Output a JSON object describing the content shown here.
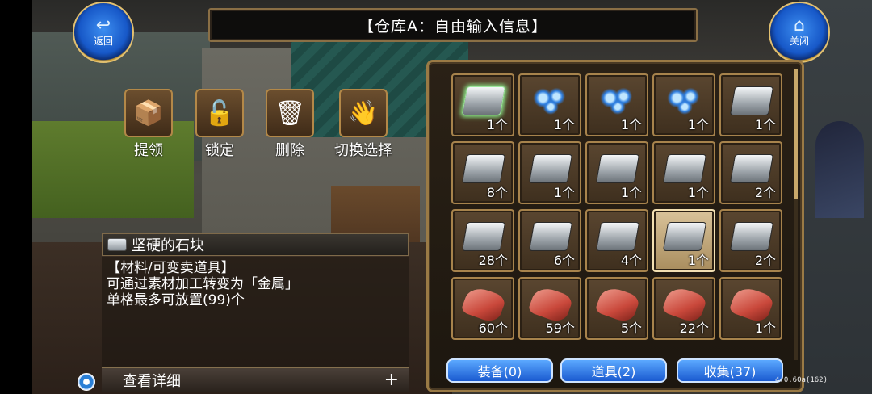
{
  "nav": {
    "back_label": "返回",
    "close_label": "关闭"
  },
  "title": "【仓库A：自由输入信息】",
  "actions": {
    "take": "提领",
    "lock": "锁定",
    "delete": "删除",
    "switch": "切换选择"
  },
  "selected_item": {
    "name": "坚硬的石块",
    "desc_lines": [
      "【材料/可变卖道具】",
      "可通过素材加工转变为「金属」",
      "单格最多可放置(99)个"
    ],
    "detail_label": "查看详细",
    "detail_plus": "+"
  },
  "inventory": {
    "slots": [
      {
        "icon": "rare-ingot-icon",
        "count": "1个"
      },
      {
        "icon": "blue-crystal-icon",
        "count": "1个"
      },
      {
        "icon": "blue-crystal-icon",
        "count": "1个"
      },
      {
        "icon": "blue-crystal-icon",
        "count": "1个"
      },
      {
        "icon": "ingot-icon",
        "count": "1个"
      },
      {
        "icon": "ingot-icon",
        "count": "8个"
      },
      {
        "icon": "ingot-icon",
        "count": "1个"
      },
      {
        "icon": "ingot-icon",
        "count": "1个"
      },
      {
        "icon": "ingot-icon",
        "count": "1个"
      },
      {
        "icon": "ingot-icon",
        "count": "2个"
      },
      {
        "icon": "ingot-icon",
        "count": "28个"
      },
      {
        "icon": "ingot-icon",
        "count": "6个"
      },
      {
        "icon": "ingot-icon",
        "count": "4个"
      },
      {
        "icon": "ingot-icon",
        "count": "1个",
        "selected": true
      },
      {
        "icon": "ingot-icon",
        "count": "2个"
      },
      {
        "icon": "red-cloth-icon",
        "count": "60个"
      },
      {
        "icon": "red-cloth-icon",
        "count": "59个"
      },
      {
        "icon": "red-cloth-icon",
        "count": "5个"
      },
      {
        "icon": "red-cloth-icon",
        "count": "22个"
      },
      {
        "icon": "red-cloth-icon",
        "count": "1个"
      }
    ]
  },
  "tabs": {
    "equip": "装备(0)",
    "items": "道具(2)",
    "collect": "收集(37)"
  },
  "version": "4.0.60a(162)"
}
